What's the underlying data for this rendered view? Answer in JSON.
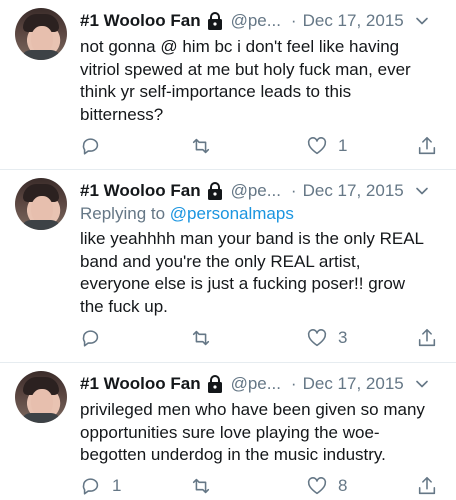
{
  "tweets": [
    {
      "name": "#1 Wooloo Fan",
      "handle": "@pe...",
      "separator": "·",
      "date": "Dec 17, 2015",
      "replying_label": "",
      "replying_mention": "",
      "lines": [
        "not gonna @ him bc i don't feel like having",
        "vitriol spewed at me but holy fuck man, ever",
        "think yr self-importance leads to this",
        "bitterness?"
      ],
      "reply_count": "",
      "retweet_count": "",
      "like_count": "1"
    },
    {
      "name": "#1 Wooloo Fan",
      "handle": "@pe...",
      "separator": "·",
      "date": "Dec 17, 2015",
      "replying_label": "Replying to ",
      "replying_mention": "@personalmaps",
      "lines": [
        "like yeahhhh man your band is the only REAL",
        "band and you're the only REAL artist,",
        "everyone else is just a fucking poser!! grow",
        "the fuck up."
      ],
      "reply_count": "",
      "retweet_count": "",
      "like_count": "3"
    },
    {
      "name": "#1 Wooloo Fan",
      "handle": "@pe...",
      "separator": "·",
      "date": "Dec 17, 2015",
      "replying_label": "",
      "replying_mention": "",
      "lines": [
        "privileged men who have been given so many",
        "opportunities sure love playing the woe-",
        "begotten underdog in the music industry."
      ],
      "reply_count": "1",
      "retweet_count": "",
      "like_count": "8"
    }
  ],
  "icons": {
    "lock": "lock-icon",
    "chevron": "chevron-down-icon",
    "reply": "reply-icon",
    "retweet": "retweet-icon",
    "like": "heart-icon",
    "share": "share-icon"
  },
  "colors": {
    "text": "#14171a",
    "secondary": "#657786",
    "link": "#1b95e0",
    "divider": "#e6ecf0"
  }
}
